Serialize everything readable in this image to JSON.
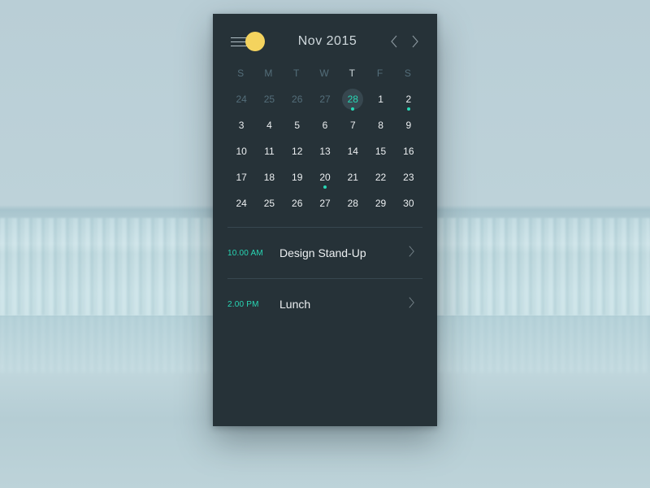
{
  "header": {
    "month_label": "Nov 2015"
  },
  "weekdays": [
    "S",
    "M",
    "T",
    "W",
    "T",
    "F",
    "S"
  ],
  "today_weekday_index": 4,
  "colors": {
    "accent": "#28d7b5",
    "sun": "#f4d35e",
    "card_bg": "#263238"
  },
  "selected_day": 28,
  "rows": [
    [
      {
        "n": 24,
        "faded": true
      },
      {
        "n": 25,
        "faded": true
      },
      {
        "n": 26,
        "faded": true
      },
      {
        "n": 27,
        "faded": true
      },
      {
        "n": 28,
        "selected": true,
        "dot": true
      },
      {
        "n": 1
      },
      {
        "n": 2,
        "dot": true
      }
    ],
    [
      {
        "n": 3
      },
      {
        "n": 4
      },
      {
        "n": 5
      },
      {
        "n": 6
      },
      {
        "n": 7
      },
      {
        "n": 8
      },
      {
        "n": 9
      }
    ],
    [
      {
        "n": 10
      },
      {
        "n": 11
      },
      {
        "n": 12
      },
      {
        "n": 13
      },
      {
        "n": 14
      },
      {
        "n": 15
      },
      {
        "n": 16
      }
    ],
    [
      {
        "n": 17
      },
      {
        "n": 18
      },
      {
        "n": 19
      },
      {
        "n": 20,
        "dot": true
      },
      {
        "n": 21
      },
      {
        "n": 22
      },
      {
        "n": 23
      }
    ],
    [
      {
        "n": 24
      },
      {
        "n": 25
      },
      {
        "n": 26
      },
      {
        "n": 27
      },
      {
        "n": 28
      },
      {
        "n": 29
      },
      {
        "n": 30
      }
    ]
  ],
  "events": [
    {
      "time": "10.00 AM",
      "label": "Design Stand-Up"
    },
    {
      "time": "2.00 PM",
      "label": "Lunch"
    }
  ]
}
